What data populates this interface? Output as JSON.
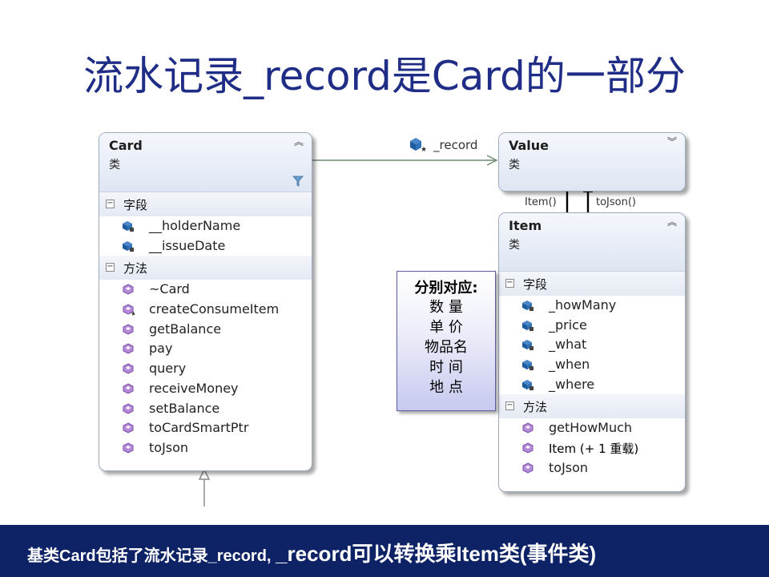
{
  "title": "流水记录_record是Card的一部分",
  "card": {
    "name": "Card",
    "kind": "类",
    "fields_label": "字段",
    "fields": [
      "__holderName",
      "__issueDate"
    ],
    "methods_label": "方法",
    "methods": [
      "~Card",
      "createConsumeItem",
      "getBalance",
      "pay",
      "query",
      "receiveMoney",
      "setBalance",
      "toCardSmartPtr",
      "toJson"
    ]
  },
  "value": {
    "name": "Value",
    "kind": "类"
  },
  "item": {
    "name": "Item",
    "kind": "类",
    "fields_label": "字段",
    "fields": [
      "_howMany",
      "_price",
      "_what",
      "_when",
      "_where"
    ],
    "methods_label": "方法",
    "methods": [
      "getHowMuch",
      "Item (+ 1 重载)",
      "toJson"
    ]
  },
  "relations": {
    "record_label": "_record",
    "item_call": "Item()",
    "tojson_call": "toJson()"
  },
  "callout": {
    "heading": "分别对应:",
    "lines": [
      "数  量",
      "单  价",
      "物品名",
      "时  间",
      "地  点"
    ]
  },
  "footer": {
    "part1": "基类Card包括了流水记录_record, ",
    "part2": "_record可以转换乘Item类(事件类)"
  }
}
